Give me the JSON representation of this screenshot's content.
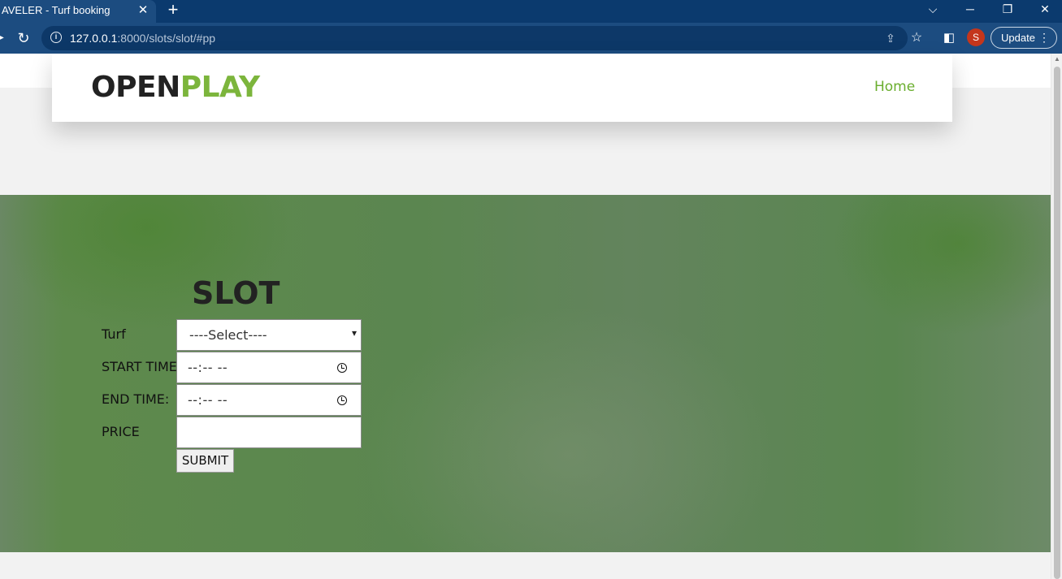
{
  "browser": {
    "tab_title": "AVELER - Turf booking",
    "tab_close": "✕",
    "new_tab": "+",
    "url_host": "127.0.0.1",
    "url_rest": ":8000/slots/slot/#pp",
    "profile_initial": "S",
    "update_label": "Update"
  },
  "navbar": {
    "logo_part1": "OPEN",
    "logo_part2": "PLAY",
    "home_link": "Home"
  },
  "form": {
    "title": "SLOT",
    "turf_label": "Turf",
    "turf_selected": "----Select----",
    "start_label": "START TIME:",
    "start_value": "--:-- --",
    "end_label": "END TIME:",
    "end_value": "--:-- --",
    "price_label": "PRICE",
    "price_value": "",
    "submit_label": "SUBMIT"
  },
  "colors": {
    "logo_dark": "#222222",
    "logo_green": "#7cb53c",
    "hero_green": "#5b8650",
    "browser_blue": "#1c4c80"
  }
}
